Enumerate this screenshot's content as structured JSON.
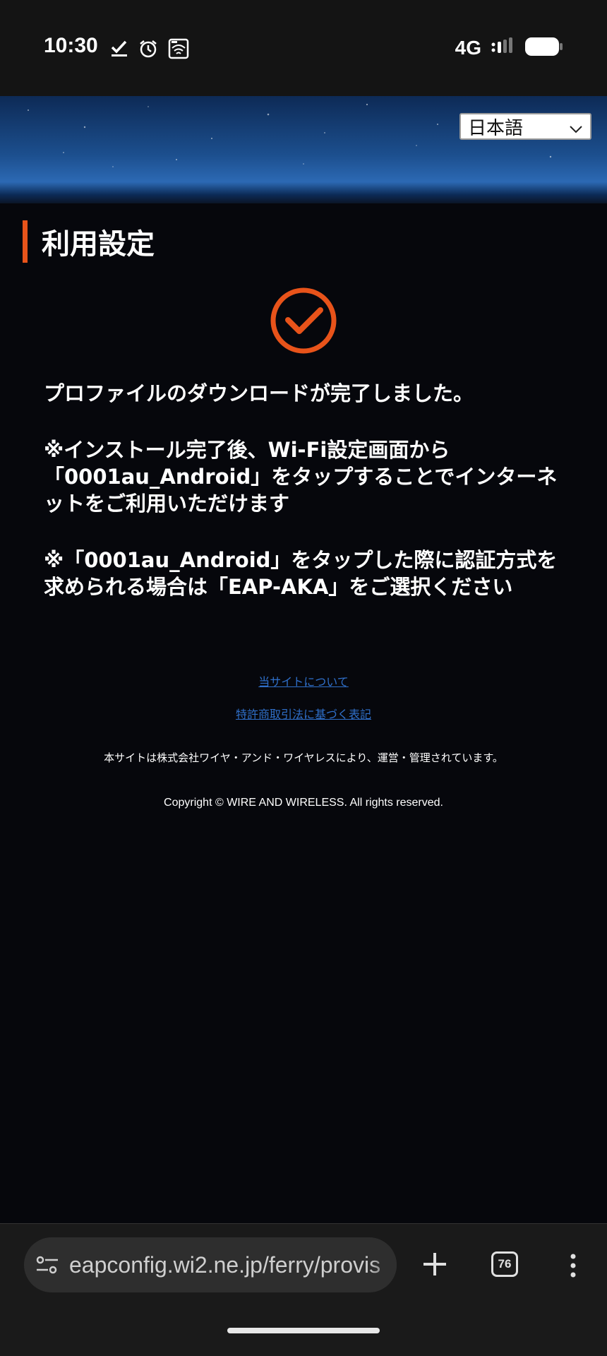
{
  "status_bar": {
    "time": "10:30",
    "network": "4G",
    "icons": [
      "check-download-icon",
      "alarm-icon",
      "wifi-calling-icon",
      "signal-icon",
      "battery-icon"
    ]
  },
  "language_select": {
    "selected": "日本語"
  },
  "page": {
    "title": "利用設定",
    "accent_color": "#e8531a",
    "success_icon": "check-circle-icon",
    "message_main": "プロファイルのダウンロードが完了しました。",
    "message_note1": "※インストール完了後、Wi-Fi設定画面から「0001au_Android」をタップすることでインターネットをご利用いただけます",
    "message_note2": "※「0001au_Android」をタップした際に認証方式を求められる場合は「EAP-AKA」をご選択ください"
  },
  "footer": {
    "link_about": "当サイトについて",
    "link_legal": "特許商取引法に基づく表記",
    "operator_note": "本サイトは株式会社ワイヤ・アンド・ワイヤレスにより、運営・管理されています。",
    "copyright": "Copyright © WIRE AND WIRELESS. All rights reserved.",
    "link_color": "#2f6fc9"
  },
  "browser_bar": {
    "url": "eapconfig.wi2.ne.jp/ferry/provis",
    "tab_count": "76"
  }
}
